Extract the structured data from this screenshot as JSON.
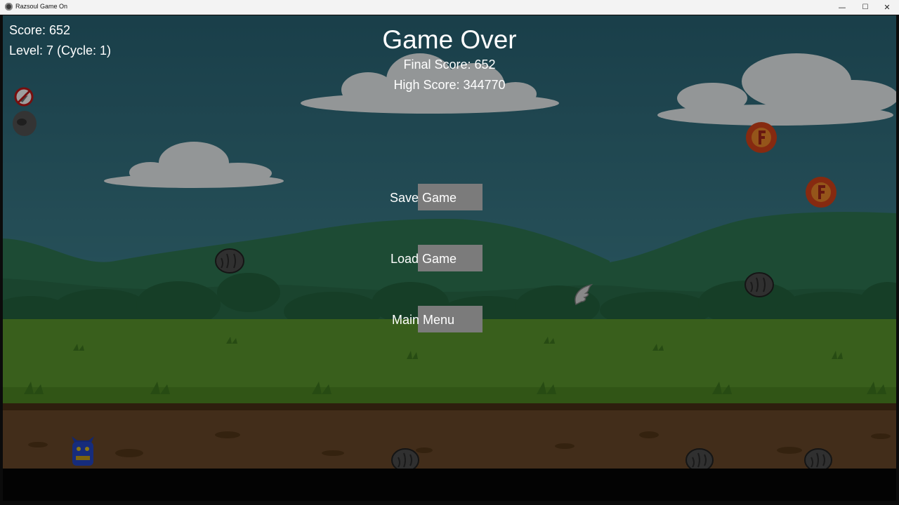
{
  "window": {
    "title": "Razsoul Game On",
    "controls": {
      "minimize": "—",
      "maximize": "☐",
      "close": "✕"
    }
  },
  "hud": {
    "score": "Score: 652",
    "level": "Level: 7 (Cycle: 1)",
    "status_icons": [
      "no-fire-powerup-icon",
      "boulder-powerup-icon"
    ]
  },
  "game_over": {
    "title": "Game Over",
    "final_score": "Final Score: 652",
    "high_score": "High Score: 344770"
  },
  "menu": {
    "save_label": "Save Game",
    "load_label": "Load Game",
    "main_menu_label": "Main Menu"
  },
  "sprites": [
    "player-cat-sprite",
    "rock-enemy-sprite",
    "fire-orb-pickup",
    "wing-pickup"
  ],
  "colors": {
    "sky": "#2e6e80",
    "hills": "#2f7a55",
    "grass": "#5d9a2e",
    "dirt": "#6b4a2a",
    "button": "#7b7b7b",
    "text": "#ffffff"
  }
}
